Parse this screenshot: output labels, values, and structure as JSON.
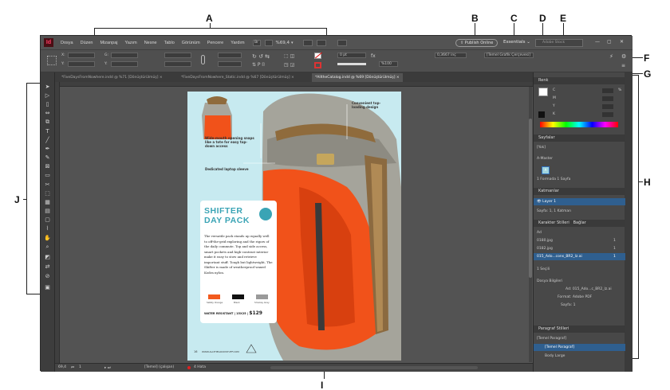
{
  "callouts": [
    "A",
    "B",
    "C",
    "D",
    "E",
    "F",
    "G",
    "H",
    "I",
    "J"
  ],
  "app": {
    "logo": "Id",
    "menu": [
      "Dosya",
      "Düzen",
      "Mizanpaj",
      "Yazım",
      "Nesne",
      "Tablo",
      "Görünüm",
      "Pencere",
      "Yardım"
    ],
    "br_badge": "Br",
    "zoom": "%69,4",
    "publish_label": "Publish Online",
    "workspace": "Essentials",
    "search_placeholder": "Adobe Stock",
    "controls": {
      "stroke_weight": "0 pt",
      "measure": "0,3667 inç",
      "percent": "%100",
      "frame_style": "[Temel Grafik Çerçevesi]"
    }
  },
  "tabs": [
    "*FiveDaysFromNowhere.indd @ %71 [Dönüştürülmüş]",
    "*FiveDaysFromNowhere_Static.indd @ %67 [Dönüştürülmüş]",
    "*AlltheCatalog.indd @ %69 [Dönüştürülmüş]"
  ],
  "page": {
    "callout_top_right": "Convenient top-loading design",
    "callout_top_left": "Wide-mouth opening snaps like a tote for easy top-down access",
    "callout_sleeve": "Dedicated laptop sleeve",
    "card": {
      "title_line1": "SHIFTER",
      "title_line2": "DAY PACK",
      "body": "The versatile pack stands up equally well to off-the-grid exploring and the rigors of the daily commute. Top and side access, smart pockets and high-contrast interior make it easy to stow and retrieve important stuff. Tough but lightweight, The Shifter is made of weatherproof waxed Kodra nylon.",
      "swatches": [
        {
          "color": "#f25a1e",
          "label": "Safety Orange"
        },
        {
          "color": "#111111",
          "label": "Black"
        },
        {
          "color": "#9a9a9a",
          "label": "Smokey Grey"
        }
      ],
      "price_prefix": "WATER RESISTANT | 15X25 |",
      "price": "$129"
    },
    "footer_page": "16",
    "footer_url": "WWW.ALLTHEGOODSTUFF.COM"
  },
  "status": {
    "zoom": "69,4",
    "page_number": "1",
    "style": "[Temel] (çalışan)",
    "errors": "4 Hata"
  },
  "panels": {
    "color": {
      "title": "Renk",
      "channels": [
        "C",
        "M",
        "Y",
        "K"
      ],
      "unit": "%"
    },
    "pages": {
      "title": "Sayfalar",
      "none_label": "[Yok]",
      "master_label": "A-Master",
      "page_thumb_label": "A",
      "footer": "1 Formada 1 Sayfa"
    },
    "layers": {
      "title": "Katmanlar",
      "layer_name": "Layer 1",
      "footer": "Sayfa: 1, 1 Katman"
    },
    "links": {
      "tab_char_styles": "Karakter Stilleri",
      "tab_links": "Bağlar",
      "column": "Ad",
      "items": [
        {
          "name": "0180.jpg",
          "page": "1"
        },
        {
          "name": "0182.jpg",
          "page": "1"
        },
        {
          "name": "015_Ado...cons_BR2_lz.ai",
          "page": "1"
        }
      ],
      "footer": "1 Seçili",
      "info_title": "Dosya Bilgileri",
      "info_name_label": "Ad:",
      "info_name": "015_Ado...c_BR2_lz.ai",
      "info_format_label": "Format:",
      "info_format": "Adobe PDF",
      "info_page_label": "Sayfa:",
      "info_page": "1"
    },
    "para": {
      "title": "Paragraf Stilleri",
      "items": [
        "[Temel Paragraf]",
        "[Temel Paragraf]",
        "Body Large"
      ]
    }
  }
}
